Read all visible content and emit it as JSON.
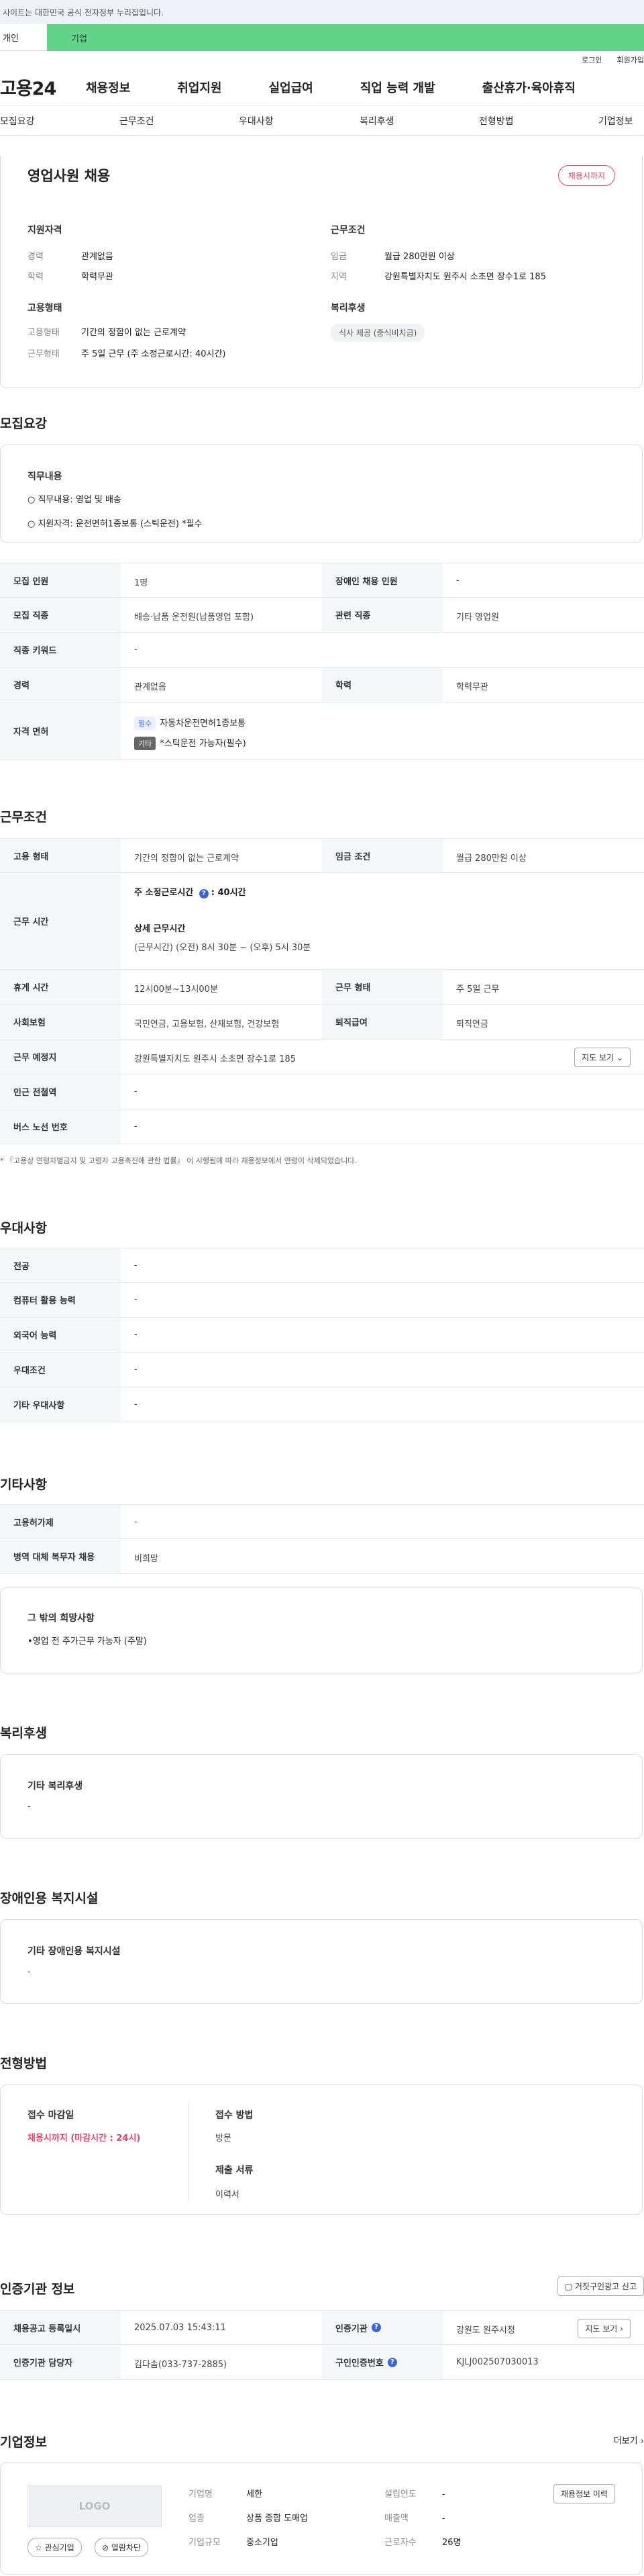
{
  "notice": "사이트는 대한민국 공식 전자정부 누리집입니다.",
  "tabs": [
    "개인",
    "기업"
  ],
  "util": [
    "로그인",
    "회원가입"
  ],
  "logo": "고용24",
  "gnb": [
    "채용정보",
    "취업지원",
    "실업급여",
    "직업 능력 개발",
    "출산휴가·육아휴직"
  ],
  "subnav": [
    "모집요강",
    "근무조건",
    "우대사항",
    "복리후생",
    "전형방법",
    "기업정보"
  ],
  "summary": {
    "title": "영업사원 채용",
    "badge": "채용시까지",
    "qual_title": "지원자격",
    "qual": [
      {
        "k": "경력",
        "v": "관계없음"
      },
      {
        "k": "학력",
        "v": "학력무관"
      }
    ],
    "work_title": "근무조건",
    "work": [
      {
        "k": "임금",
        "v": "월급 280만원 이상"
      },
      {
        "k": "지역",
        "v": "강원특별자치도 원주시 소초면 장수1로 185"
      }
    ],
    "emp_title": "고용형태",
    "emp": [
      {
        "k": "고용형태",
        "v": "기간의 정함이 없는 근로계약"
      },
      {
        "k": "근무형태",
        "v": "주 5일 근무 (주 소정근로시간: 40시간)"
      }
    ],
    "welfare_title": "복리후생",
    "welfare_tag": "식사 제공 (중식비지급)"
  },
  "recruit": {
    "title": "모집요강",
    "duty_title": "직무내용",
    "duty_lines": [
      "○ 직무내용: 영업 및 배송",
      "○ 지원자격: 운전면허1종보통 (스틱운전) *필수"
    ],
    "rows": [
      {
        "l1": "모집 인원",
        "v1": "1명",
        "l2": "장애인 채용 인원",
        "v2": "-"
      },
      {
        "l1": "모집 직종",
        "v1": "배송·납품 운전원(납품영업 포함)",
        "l2": "관련 직종",
        "v2": "기타 영업원"
      },
      {
        "l1": "직종 키워드",
        "v1": "-"
      },
      {
        "l1": "경력",
        "v1": "관계없음",
        "l2": "학력",
        "v2": "학력무관"
      }
    ],
    "license_label": "자격 면허",
    "license_tag1": "필수",
    "license_1": "자동차운전면허1종보통",
    "license_tag2": "기타",
    "license_2": "*스틱운전 가능자(필수)"
  },
  "work": {
    "title": "근무조건",
    "emp_label": "고용 형태",
    "emp_value": "기간의 정함이 없는 근로계약",
    "wage_label": "임금 조건",
    "wage_value": "월급 280만원 이상",
    "hours_label": "근무 시간",
    "hours_week_prefix": "주 소정근로시간",
    "hours_week_value": "40시간",
    "hours_detail_title": "상세 근무시간",
    "hours_detail": "(근무시간) (오전) 8시 30분 ~ (오후) 5시 30분",
    "rows": [
      {
        "l1": "휴게 시간",
        "v1": "12시00분~13시00분",
        "l2": "근무 형태",
        "v2": "주 5일 근무"
      },
      {
        "l1": "사회보험",
        "v1": "국민연금, 고용보험, 산재보험, 건강보험",
        "l2": "퇴직급여",
        "v2": "퇴직연금"
      }
    ],
    "place_label": "근무 예정지",
    "place_value": "강원특별자치도 원주시 소초면 장수1로 185",
    "map_btn": "지도 보기",
    "subway_label": "인근 전철역",
    "subway_value": "-",
    "bus_label": "버스 노선 번호",
    "bus_value": "-",
    "footnote": "* 『고용상 연령차별금지 및 고령자 고용촉진에 관한 법률』 이 시행됨에 따라 채용정보에서 연령이 삭제되었습니다."
  },
  "pref": {
    "title": "우대사항",
    "rows": [
      {
        "l": "전공",
        "v": "-"
      },
      {
        "l": "컴퓨터 활용 능력",
        "v": "-"
      },
      {
        "l": "외국어 능력",
        "v": "-"
      },
      {
        "l": "우대조건",
        "v": "-"
      },
      {
        "l": "기타 우대사항",
        "v": "-"
      }
    ]
  },
  "etc": {
    "title": "기타사항",
    "rows": [
      {
        "l": "고용허가제",
        "v": "-"
      },
      {
        "l": "병역 대체 복무자 채용",
        "v": "비희망"
      }
    ],
    "wish_title": "그 밖의 희망사항",
    "wish_value": "•영업 전 주가근무 가능자 (주말)"
  },
  "benefit": {
    "title": "복리후생",
    "sub": "기타 복리후생",
    "value": "-"
  },
  "disabled": {
    "title": "장애인용 복지시설",
    "sub": "기타 장애인용 복지시설",
    "value": "-"
  },
  "method": {
    "title": "전형방법",
    "deadline_label": "접수 마감일",
    "deadline_value": "채용시까지 (마감시간 : 24시)",
    "apply_label": "접수 방법",
    "apply_value": "방문",
    "docs_label": "제출 서류",
    "docs_value": "이력서"
  },
  "agency": {
    "title": "인증기관 정보",
    "report_btn": "거짓구인광고 신고",
    "rows": [
      {
        "l1": "채용공고 등록일시",
        "v1": "2025.07.03 15:43:11",
        "l2": "인증기관",
        "v2": "강원도 원주시청"
      },
      {
        "l1": "인증기관 담당자",
        "v1": "김다솜(033-737-2885)",
        "l2": "구인인증번호",
        "v2": "KJLJ002507030013"
      }
    ],
    "map_btn": "지도 보기"
  },
  "company": {
    "title": "기업정보",
    "more": "더보기",
    "logo_text": "LOGO",
    "fav_btn": "관심기업",
    "block_btn": "열람차단",
    "info": [
      {
        "k": "기업명",
        "v": "세한",
        "k2": "설립연도",
        "v2": "-"
      },
      {
        "k": "업종",
        "v": "상품 종합 도매업",
        "k2": "매출액",
        "v2": "-"
      },
      {
        "k": "기업규모",
        "v": "중소기업",
        "k2": "근로자수",
        "v2": "26명"
      }
    ],
    "history_btn": "채용정보 이력"
  }
}
